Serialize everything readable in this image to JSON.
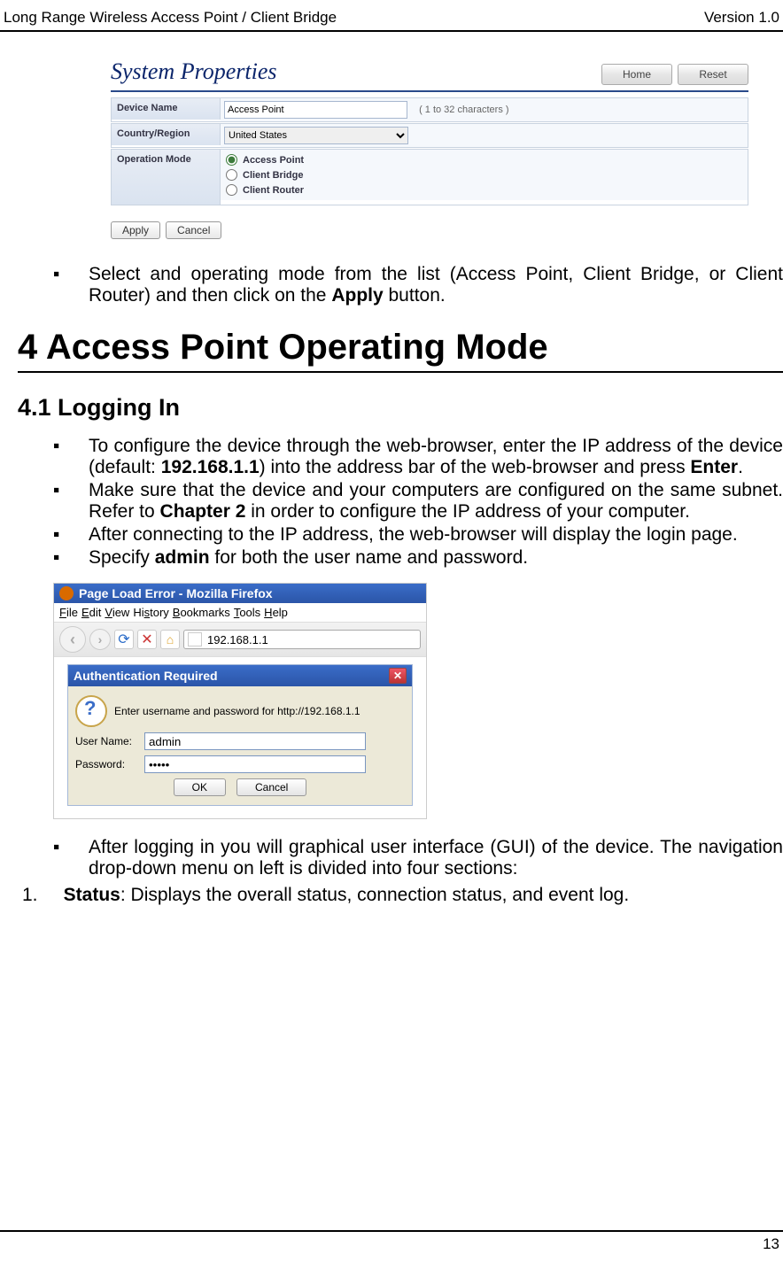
{
  "header": {
    "left": "Long Range Wireless Access Point / Client Bridge",
    "right": "Version 1.0"
  },
  "sys_panel": {
    "title": "System Properties",
    "home_btn": "Home",
    "reset_btn": "Reset",
    "device_name_label": "Device Name",
    "device_name_value": "Access Point",
    "device_name_hint": "( 1 to 32 characters )",
    "country_label": "Country/Region",
    "country_value": "United States",
    "opmode_label": "Operation Mode",
    "opmode_1": "Access Point",
    "opmode_2": "Client Bridge",
    "opmode_3": "Client Router",
    "apply_btn": "Apply",
    "cancel_btn": "Cancel"
  },
  "bullets": {
    "b0_a": "Select and operating mode from the list (Access Point, Client Bridge, or Client Router) and then click on the ",
    "b0_b": "Apply",
    "b0_c": " button."
  },
  "section_title": "4 Access Point Operating Mode",
  "subsection_title": "4.1   Logging In",
  "login_bullets": {
    "i1_a": "To configure the device through the web-browser, enter the IP address of the device (default: ",
    "i1_b": "192.168.1.1",
    "i1_c": ") into the address bar of the web-browser and press ",
    "i1_d": "Enter",
    "i1_e": ".",
    "i2_a": "Make sure that the device and your computers are configured on the same subnet. Refer to ",
    "i2_b": "Chapter 2",
    "i2_c": " in order to configure the IP address of your computer.",
    "i3": "After connecting to the IP address, the web-browser will display the login page.",
    "i4_a": "Specify ",
    "i4_b": "admin",
    "i4_c": " for both the user name and password."
  },
  "ff": {
    "title": "Page Load Error - Mozilla Firefox",
    "menu_file": "File",
    "menu_edit": "Edit",
    "menu_view": "View",
    "menu_history": "History",
    "menu_bookmarks": "Bookmarks",
    "menu_tools": "Tools",
    "menu_help": "Help",
    "address": "192.168.1.1",
    "auth_title": "Authentication Required",
    "auth_msg": "Enter username and password for http://192.168.1.1",
    "user_label": "User Name:",
    "pass_label": "Password:",
    "user_value": "admin",
    "pass_value": "•••••",
    "ok_btn": "OK",
    "cancel_btn": "Cancel"
  },
  "after_bullets": {
    "a1": "After logging in you will graphical user interface (GUI) of the device. The navigation drop-down menu on left is divided into four sections:",
    "n1_a": "Status",
    "n1_b": ": Displays the overall status, connection status, and event log."
  },
  "footer_page": "13"
}
